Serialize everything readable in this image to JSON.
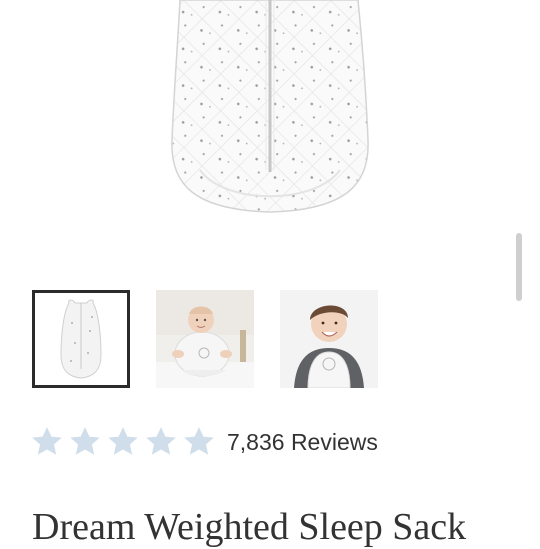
{
  "product": {
    "title": "Dream Weighted Sleep Sack",
    "reviews_label": "7,836 Reviews",
    "rating": 5,
    "star_color": "#cfdeea"
  },
  "gallery": {
    "main_image": "quilted-star-print-sleep-sack",
    "thumbnails": [
      {
        "name": "sleep-sack-product",
        "selected": true
      },
      {
        "name": "baby-sitting-in-sleep-sack",
        "selected": false
      },
      {
        "name": "toddler-wearing-sleep-sack",
        "selected": false
      }
    ]
  }
}
